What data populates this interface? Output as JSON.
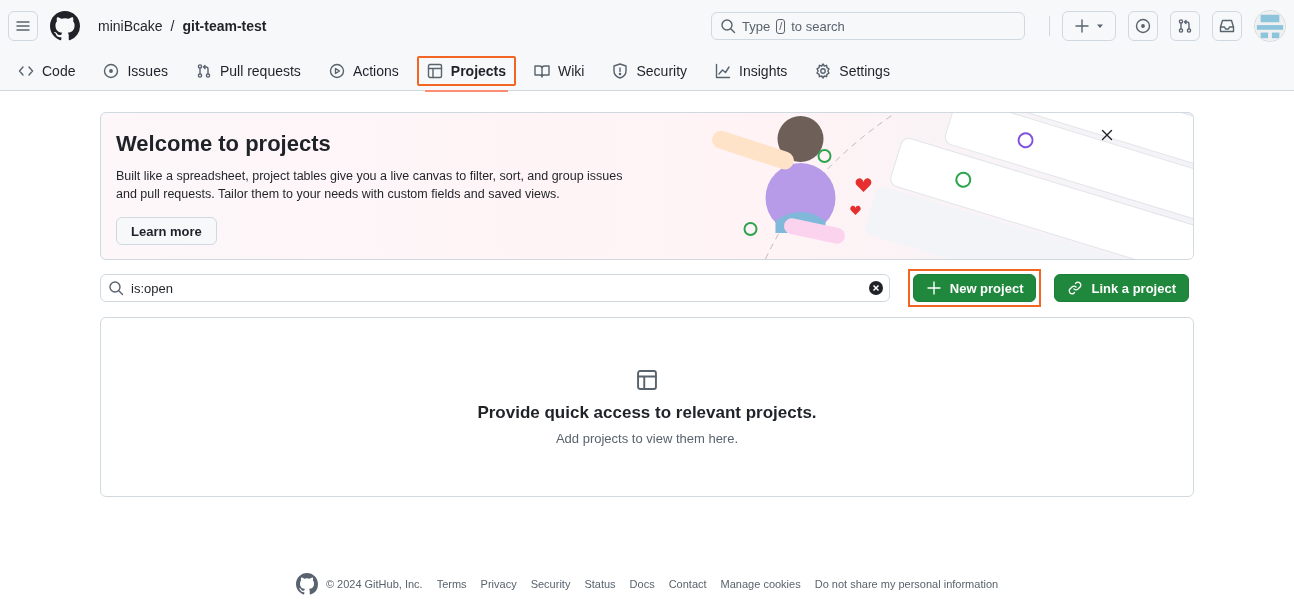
{
  "header": {
    "owner": "miniBcake",
    "separator": "/",
    "repo": "git-team-test",
    "search_placeholder_before": "Type",
    "search_key": "/",
    "search_placeholder_after": "to search"
  },
  "tabs": [
    {
      "label": "Code",
      "selected": false,
      "highlighted": false
    },
    {
      "label": "Issues",
      "selected": false,
      "highlighted": false
    },
    {
      "label": "Pull requests",
      "selected": false,
      "highlighted": false
    },
    {
      "label": "Actions",
      "selected": false,
      "highlighted": false
    },
    {
      "label": "Projects",
      "selected": true,
      "highlighted": true
    },
    {
      "label": "Wiki",
      "selected": false,
      "highlighted": false
    },
    {
      "label": "Security",
      "selected": false,
      "highlighted": false
    },
    {
      "label": "Insights",
      "selected": false,
      "highlighted": false
    },
    {
      "label": "Settings",
      "selected": false,
      "highlighted": false
    }
  ],
  "banner": {
    "title": "Welcome to projects",
    "text": "Built like a spreadsheet, project tables give you a live canvas to filter, sort, and group issues and pull requests. Tailor them to your needs with custom fields and saved views.",
    "button": "Learn more"
  },
  "filter": {
    "value": "is:open"
  },
  "actions": [
    {
      "label": "New project",
      "highlighted": true
    },
    {
      "label": "Link a project",
      "highlighted": false
    }
  ],
  "empty_state": {
    "title": "Provide quick access to relevant projects.",
    "text": "Add projects to view them here."
  },
  "footer": {
    "copyright": "© 2024 GitHub, Inc.",
    "links": [
      "Terms",
      "Privacy",
      "Security",
      "Status",
      "Docs",
      "Contact",
      "Manage cookies",
      "Do not share my personal information"
    ]
  }
}
